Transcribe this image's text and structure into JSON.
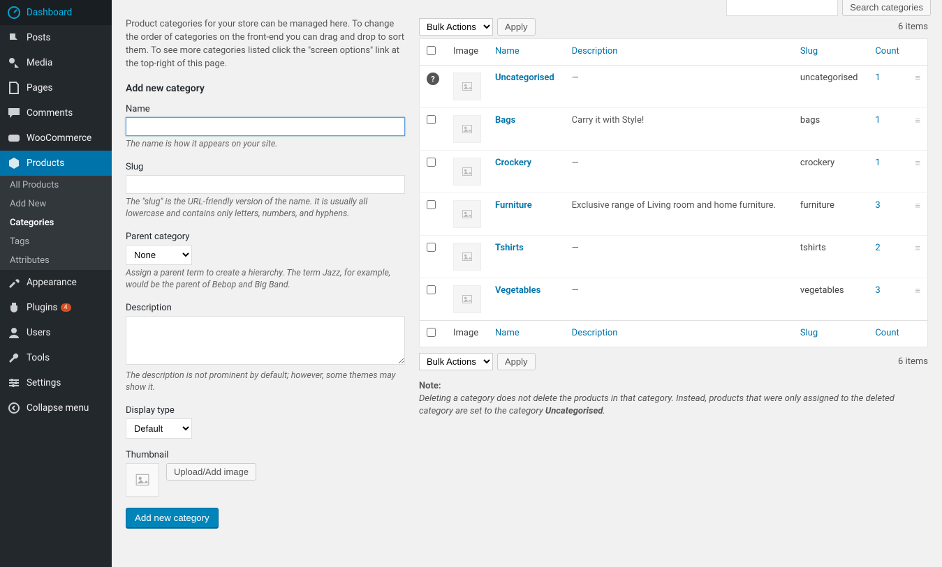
{
  "search": {
    "placeholder": "",
    "button": "Search categories"
  },
  "sidebar": {
    "items": [
      {
        "label": "Dashboard"
      },
      {
        "label": "Posts"
      },
      {
        "label": "Media"
      },
      {
        "label": "Pages"
      },
      {
        "label": "Comments"
      },
      {
        "label": "WooCommerce"
      },
      {
        "label": "Products"
      },
      {
        "label": "Appearance"
      },
      {
        "label": "Plugins",
        "badge": "4"
      },
      {
        "label": "Users"
      },
      {
        "label": "Tools"
      },
      {
        "label": "Settings"
      },
      {
        "label": "Collapse menu"
      }
    ],
    "submenu": [
      {
        "label": "All Products"
      },
      {
        "label": "Add New"
      },
      {
        "label": "Categories"
      },
      {
        "label": "Tags"
      },
      {
        "label": "Attributes"
      }
    ]
  },
  "intro": "Product categories for your store can be managed here. To change the order of categories on the front-end you can drag and drop to sort them. To see more categories listed click the \"screen options\" link at the top-right of this page.",
  "addHeading": "Add new category",
  "form": {
    "name": {
      "label": "Name",
      "help": "The name is how it appears on your site."
    },
    "slug": {
      "label": "Slug",
      "help": "The \"slug\" is the URL-friendly version of the name. It is usually all lowercase and contains only letters, numbers, and hyphens."
    },
    "parent": {
      "label": "Parent category",
      "selected": "None",
      "help": "Assign a parent term to create a hierarchy. The term Jazz, for example, would be the parent of Bebop and Big Band."
    },
    "description": {
      "label": "Description",
      "help": "The description is not prominent by default; however, some themes may show it."
    },
    "display": {
      "label": "Display type",
      "selected": "Default"
    },
    "thumb": {
      "label": "Thumbnail",
      "button": "Upload/Add image"
    },
    "submit": "Add new category"
  },
  "bulk": {
    "label": "Bulk Actions",
    "apply": "Apply"
  },
  "itemsCount": "6 items",
  "columns": {
    "image": "Image",
    "name": "Name",
    "description": "Description",
    "slug": "Slug",
    "count": "Count"
  },
  "rows": [
    {
      "name": "Uncategorised",
      "description": "—",
      "slug": "uncategorised",
      "count": "1",
      "help": true
    },
    {
      "name": "Bags",
      "description": "Carry it with Style!",
      "slug": "bags",
      "count": "1"
    },
    {
      "name": "Crockery",
      "description": "—",
      "slug": "crockery",
      "count": "1"
    },
    {
      "name": "Furniture",
      "description": "Exclusive range of Living room and home furniture.",
      "slug": "furniture",
      "count": "3"
    },
    {
      "name": "Tshirts",
      "description": "—",
      "slug": "tshirts",
      "count": "2"
    },
    {
      "name": "Vegetables",
      "description": "—",
      "slug": "vegetables",
      "count": "3"
    }
  ],
  "note": {
    "heading": "Note:",
    "body_a": "Deleting a category does not delete the products in that category. Instead, products that were only assigned to the deleted category are set to the category ",
    "body_b": "Uncategorised",
    "body_c": "."
  }
}
